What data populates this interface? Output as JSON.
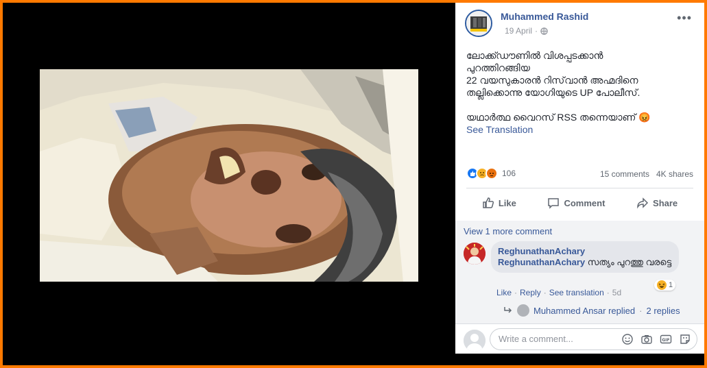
{
  "post": {
    "author": "Muhammed Rashid",
    "date": "19 April",
    "text_lines": [
      "ലോക്ക്ഡൗണിൽ വിശപ്പടക്കാൻ",
      "പുറത്തിറങ്ങിയ",
      "22 വയസുകാരൻ റിസ്‌വാൻ അഹ്മദിനെ",
      "തല്ലിക്കൊന്നു യോഗിയുടെ UP പോലീസ്."
    ],
    "text_line2": "യഥാർത്ഥ വൈറസ് RSS തന്നെയാണ് 😡",
    "see_translation": "See Translation"
  },
  "stats": {
    "reaction_count": "106",
    "comments": "15 comments",
    "shares": "4K shares"
  },
  "actions": {
    "like": "Like",
    "comment": "Comment",
    "share": "Share"
  },
  "comments_section": {
    "view_more": "View 1 more comment",
    "comment": {
      "author": "ReghunathanAchary",
      "mention": "ReghunathanAchary",
      "text": "സത്യം പുറത്തു വരട്ടെ",
      "reaction_count": "1",
      "like": "Like",
      "reply": "Reply",
      "see_translation": "See translation",
      "time": "5d"
    },
    "replies": {
      "text": "Muhammed Ansar replied",
      "count": "2 replies"
    },
    "write_placeholder": "Write a comment..."
  },
  "colors": {
    "accent": "#385898",
    "frame": "#ff7a00"
  }
}
